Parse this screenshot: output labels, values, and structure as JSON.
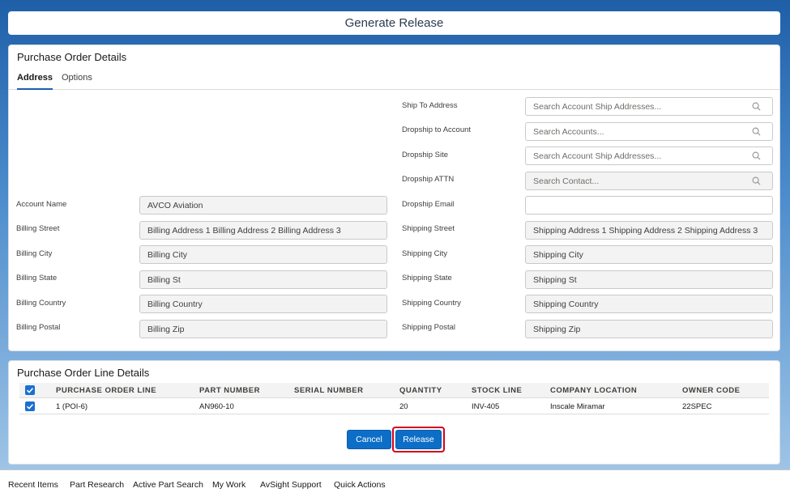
{
  "header": {
    "title": "Generate Release"
  },
  "po_details": {
    "title": "Purchase Order Details",
    "tabs": [
      {
        "label": "Address"
      },
      {
        "label": "Options"
      }
    ],
    "right_lookups": [
      {
        "label": "Ship To Address",
        "placeholder": "Search Account Ship Addresses..."
      },
      {
        "label": "Dropship to Account",
        "placeholder": "Search Accounts..."
      },
      {
        "label": "Dropship Site",
        "placeholder": "Search Account Ship Addresses..."
      },
      {
        "label": "Dropship ATTN",
        "placeholder": "Search Contact..."
      }
    ],
    "dropship_email": {
      "label": "Dropship Email",
      "value": ""
    },
    "billing": [
      {
        "label": "Account Name",
        "value": "AVCO Aviation"
      },
      {
        "label": "Billing Street",
        "value": "Billing Address 1 Billing Address 2 Billing Address 3"
      },
      {
        "label": "Billing City",
        "value": "Billing City"
      },
      {
        "label": "Billing State",
        "value": "Billing St"
      },
      {
        "label": "Billing Country",
        "value": "Billing Country"
      },
      {
        "label": "Billing Postal",
        "value": "Billing Zip"
      }
    ],
    "shipping": [
      {
        "label": "Shipping Street",
        "value": "Shipping Address 1 Shipping Address 2 Shipping Address 3"
      },
      {
        "label": "Shipping City",
        "value": "Shipping City"
      },
      {
        "label": "Shipping State",
        "value": "Shipping St"
      },
      {
        "label": "Shipping Country",
        "value": "Shipping Country"
      },
      {
        "label": "Shipping Postal",
        "value": "Shipping Zip"
      }
    ]
  },
  "line_details": {
    "title": "Purchase Order Line Details",
    "columns": [
      "PURCHASE ORDER LINE",
      "PART NUMBER",
      "SERIAL NUMBER",
      "QUANTITY",
      "STOCK LINE",
      "COMPANY LOCATION",
      "OWNER CODE"
    ],
    "rows": [
      {
        "po_line": "1 (POI-6)",
        "part_number": "AN960-10",
        "serial_number": "",
        "quantity": "20",
        "stock_line": "INV-405",
        "company_location": "Inscale Miramar",
        "owner_code": "22SPEC"
      }
    ]
  },
  "actions": {
    "cancel_label": "Cancel",
    "release_label": "Release"
  },
  "footer": {
    "items": [
      "Recent Items",
      "Part Research",
      "Active Part Search",
      "My Work",
      "AvSight Support",
      "Quick Actions"
    ]
  },
  "colors": {
    "brand": "#0d6ec7",
    "highlight": "#d0021b"
  }
}
